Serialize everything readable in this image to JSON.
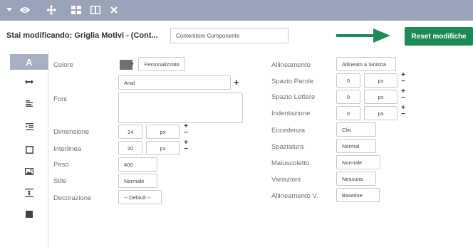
{
  "toolbar": {
    "icons": [
      "chevron-down-icon",
      "eye-icon",
      "move-icon",
      "grid-icon",
      "columns-icon",
      "close-icon"
    ]
  },
  "header": {
    "editing_label": "Stai modificando: Griglia Motivi - (Cont...",
    "component_field": "Contenitore Componente",
    "reset_label": "Reset modifiche",
    "accent_color": "#1e8a55"
  },
  "sidebar": {
    "active_label": "A",
    "items": [
      "text-style-icon",
      "spacing-icon",
      "align-icon",
      "indent-icon",
      "border-icon",
      "background-image-icon",
      "vertical-align-icon",
      "color-block-icon"
    ]
  },
  "left": {
    "colore_label": "Colore",
    "colore_button": "Personalizzato",
    "font_label": "Font",
    "font_value": "Arial",
    "dimensione_label": "Dimensione",
    "dimensione_value": "14",
    "dimensione_unit": "px",
    "interlinea_label": "Interlinea",
    "interlinea_value": "20",
    "interlinea_unit": "px",
    "peso_label": "Peso",
    "peso_value": "400",
    "stile_label": "Stile",
    "stile_value": "Normale",
    "decorazione_label": "Decorazione",
    "decorazione_value": "-- Default --"
  },
  "right": {
    "allineamento_label": "Allineamento",
    "allineamento_value": "Allineato a Sinistra",
    "spazio_parole_label": "Spazio Parole",
    "spazio_parole_value": "0",
    "spazio_parole_unit": "px",
    "spazio_lettere_label": "Spazio Lettere",
    "spazio_lettere_value": "0",
    "spazio_lettere_unit": "px",
    "indentazione_label": "Indentazione",
    "indentazione_value": "0",
    "indentazione_unit": "px",
    "eccedenza_label": "Eccedenza",
    "eccedenza_value": "Clio",
    "spaziatura_label": "Spaziatura",
    "spaziatura_value": "Normal",
    "maiuscoletto_label": "Maiuscoletto",
    "maiuscoletto_value": "Normale",
    "variazioni_label": "Variazioni",
    "variazioni_value": "Nessuna",
    "allineamento_v_label": "Allineamento V.",
    "allineamento_v_value": "Baseline"
  },
  "symbols": {
    "plus": "+",
    "minus": "−",
    "caret": "▾"
  }
}
